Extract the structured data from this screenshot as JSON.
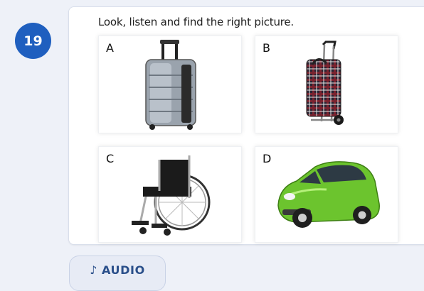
{
  "question": {
    "number": "19",
    "instruction": "Look, listen and find the right picture."
  },
  "options": [
    {
      "letter": "A",
      "picture": "suitcase"
    },
    {
      "letter": "B",
      "picture": "shopping-trolley-bag"
    },
    {
      "letter": "C",
      "picture": "wheelchair"
    },
    {
      "letter": "D",
      "picture": "small-green-car"
    }
  ],
  "audio": {
    "icon": "music-note-icon",
    "icon_glyph": "♪",
    "label": "AUDIO"
  },
  "colors": {
    "badge": "#1f5fbf",
    "page_bg": "#eef1f8",
    "audio_text": "#2a4f8a"
  }
}
